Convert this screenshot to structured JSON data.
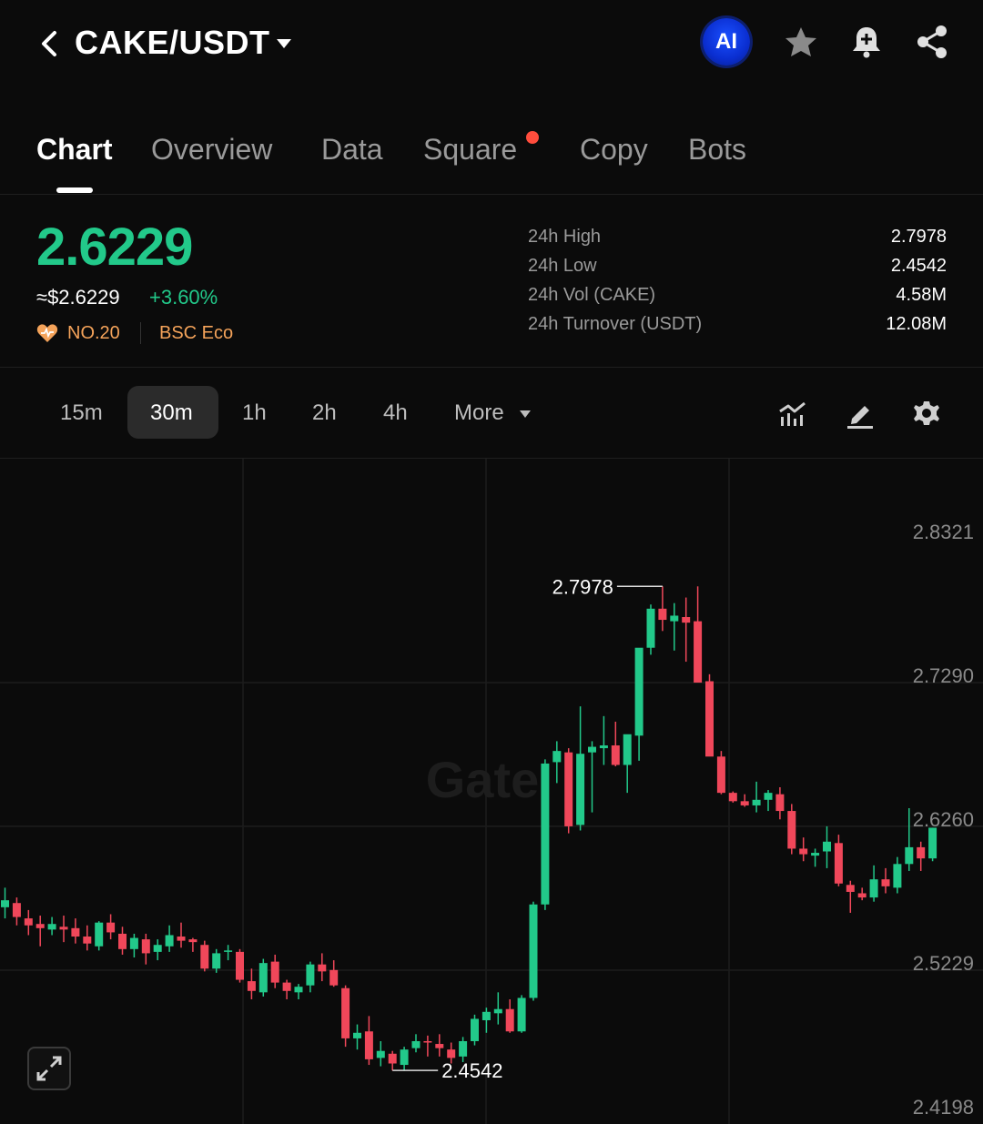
{
  "header": {
    "pair": "CAKE/USDT",
    "ai_label": "AI",
    "icons": [
      "back-arrow-icon",
      "caret-down-icon",
      "star-icon",
      "bell-plus-icon",
      "share-icon"
    ]
  },
  "tabs": [
    {
      "label": "Chart",
      "active": true
    },
    {
      "label": "Overview",
      "active": false
    },
    {
      "label": "Data",
      "active": false
    },
    {
      "label": "Square",
      "active": false,
      "dot": true
    },
    {
      "label": "Copy",
      "active": false
    },
    {
      "label": "Bots",
      "active": false
    }
  ],
  "ticker": {
    "price": "2.6229",
    "usd_price": "≈$2.6229",
    "change": "+3.60%",
    "rank": "NO.20",
    "category": "BSC Eco",
    "stats": [
      {
        "label": "24h High",
        "value": "2.7978"
      },
      {
        "label": "24h Low",
        "value": "2.4542"
      },
      {
        "label": "24h Vol (CAKE)",
        "value": "4.58M"
      },
      {
        "label": "24h Turnover (USDT)",
        "value": "12.08M"
      }
    ]
  },
  "intervals": {
    "options": [
      "15m",
      "30m",
      "1h",
      "2h",
      "4h"
    ],
    "selected": "30m",
    "more_label": "More"
  },
  "colors": {
    "up": "#22c98a",
    "down": "#f0475a",
    "accent_orange": "#f4a35a",
    "background": "#0b0b0b"
  },
  "chart_data": {
    "type": "candlestick",
    "interval": "30m",
    "y_ticks": [
      "2.8321",
      "2.7290",
      "2.6260",
      "2.5229",
      "2.4198"
    ],
    "ylim": [
      2.4198,
      2.8321
    ],
    "high_label": "2.7978",
    "low_label": "2.4542",
    "watermark": "Gate",
    "candles": [
      [
        2.568,
        2.582,
        2.56,
        2.573
      ],
      [
        2.571,
        2.575,
        2.555,
        2.561
      ],
      [
        2.56,
        2.566,
        2.548,
        2.555
      ],
      [
        2.556,
        2.562,
        2.54,
        2.553
      ],
      [
        2.552,
        2.561,
        2.548,
        2.556
      ],
      [
        2.554,
        2.562,
        2.543,
        2.552
      ],
      [
        2.553,
        2.56,
        2.542,
        2.547
      ],
      [
        2.547,
        2.555,
        2.537,
        2.542
      ],
      [
        2.54,
        2.558,
        2.537,
        2.557
      ],
      [
        2.557,
        2.563,
        2.545,
        2.55
      ],
      [
        2.549,
        2.554,
        2.534,
        2.538
      ],
      [
        2.538,
        2.549,
        2.532,
        2.546
      ],
      [
        2.545,
        2.549,
        2.527,
        2.535
      ],
      [
        2.536,
        2.545,
        2.53,
        2.541
      ],
      [
        2.54,
        2.555,
        2.536,
        2.548
      ],
      [
        2.547,
        2.557,
        2.539,
        2.544
      ],
      [
        2.545,
        2.546,
        2.536,
        2.543
      ],
      [
        2.541,
        2.544,
        2.522,
        2.524
      ],
      [
        2.524,
        2.538,
        2.521,
        2.535
      ],
      [
        2.536,
        2.541,
        2.53,
        2.537
      ],
      [
        2.536,
        2.538,
        2.514,
        2.516
      ],
      [
        2.515,
        2.524,
        2.502,
        2.508
      ],
      [
        2.507,
        2.531,
        2.504,
        2.528
      ],
      [
        2.529,
        2.534,
        2.51,
        2.514
      ],
      [
        2.514,
        2.516,
        2.502,
        2.508
      ],
      [
        2.507,
        2.513,
        2.502,
        2.511
      ],
      [
        2.512,
        2.529,
        2.507,
        2.527
      ],
      [
        2.527,
        2.535,
        2.515,
        2.522
      ],
      [
        2.523,
        2.53,
        2.511,
        2.512
      ],
      [
        2.51,
        2.512,
        2.468,
        2.474
      ],
      [
        2.474,
        2.484,
        2.466,
        2.478
      ],
      [
        2.479,
        2.49,
        2.455,
        2.459
      ],
      [
        2.46,
        2.472,
        2.454,
        2.465
      ],
      [
        2.463,
        2.465,
        2.451,
        2.456
      ],
      [
        2.455,
        2.468,
        2.451,
        2.466
      ],
      [
        2.467,
        2.477,
        2.464,
        2.472
      ],
      [
        2.472,
        2.476,
        2.461,
        2.471
      ],
      [
        2.47,
        2.477,
        2.461,
        2.467
      ],
      [
        2.466,
        2.471,
        2.456,
        2.46
      ],
      [
        2.461,
        2.475,
        2.457,
        2.472
      ],
      [
        2.472,
        2.491,
        2.469,
        2.488
      ],
      [
        2.487,
        2.496,
        2.478,
        2.493
      ],
      [
        2.492,
        2.507,
        2.484,
        2.495
      ],
      [
        2.495,
        2.502,
        2.478,
        2.479
      ],
      [
        2.479,
        2.505,
        2.478,
        2.503
      ],
      [
        2.503,
        2.572,
        2.501,
        2.57
      ],
      [
        2.57,
        2.674,
        2.566,
        2.671
      ],
      [
        2.672,
        2.687,
        2.657,
        2.68
      ],
      [
        2.679,
        2.682,
        2.621,
        2.626
      ],
      [
        2.627,
        2.712,
        2.623,
        2.678
      ],
      [
        2.679,
        2.687,
        2.636,
        2.683
      ],
      [
        2.682,
        2.705,
        2.67,
        2.684
      ],
      [
        2.684,
        2.701,
        2.669,
        2.67
      ],
      [
        2.67,
        2.68,
        2.65,
        2.692
      ],
      [
        2.691,
        2.702,
        2.673,
        2.754
      ],
      [
        2.754,
        2.785,
        2.749,
        2.782
      ],
      [
        2.782,
        2.798,
        2.766,
        2.774
      ],
      [
        2.773,
        2.786,
        2.752,
        2.777
      ],
      [
        2.776,
        2.79,
        2.744,
        2.772
      ],
      [
        2.773,
        2.798,
        2.736,
        2.729
      ],
      [
        2.73,
        2.735,
        2.677,
        2.676
      ],
      [
        2.676,
        2.68,
        2.649,
        2.65
      ],
      [
        2.65,
        2.651,
        2.643,
        2.644
      ],
      [
        2.644,
        2.649,
        2.64,
        2.641
      ],
      [
        2.641,
        2.658,
        2.636,
        2.645
      ],
      [
        2.645,
        2.652,
        2.637,
        2.65
      ],
      [
        2.649,
        2.654,
        2.631,
        2.637
      ],
      [
        2.637,
        2.642,
        2.606,
        2.61
      ],
      [
        2.61,
        2.618,
        2.601,
        2.606
      ],
      [
        2.605,
        2.61,
        2.597,
        2.607
      ],
      [
        2.608,
        2.626,
        2.596,
        2.615
      ],
      [
        2.614,
        2.62,
        2.583,
        2.585
      ],
      [
        2.584,
        2.587,
        2.564,
        2.579
      ],
      [
        2.578,
        2.582,
        2.573,
        2.575
      ],
      [
        2.575,
        2.598,
        2.572,
        2.588
      ],
      [
        2.588,
        2.596,
        2.578,
        2.583
      ],
      [
        2.582,
        2.604,
        2.578,
        2.599
      ],
      [
        2.599,
        2.639,
        2.594,
        2.611
      ],
      [
        2.611,
        2.615,
        2.594,
        2.603
      ],
      [
        2.603,
        2.625,
        2.601,
        2.625
      ]
    ]
  }
}
